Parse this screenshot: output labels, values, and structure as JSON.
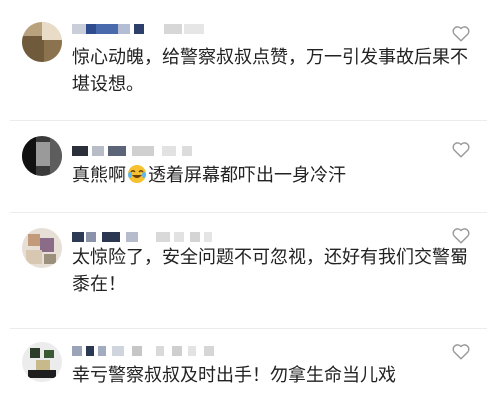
{
  "comments": [
    {
      "text": "惊心动魄，给警察叔叔点赞，万一引发事故后果不堪设想。",
      "username": "",
      "like_icon": "heart-outline-icon"
    },
    {
      "text_before_emoji": "真熊啊",
      "emoji": "laughing-crying-emoji",
      "text_after_emoji": "透着屏幕都吓出一身冷汗",
      "username": "",
      "like_icon": "heart-outline-icon"
    },
    {
      "text": "太惊险了，安全问题不可忽视，还好有我们交警蜀黍在！",
      "username": "",
      "like_icon": "heart-outline-icon"
    },
    {
      "text": "幸亏警察叔叔及时出手！勿拿生命当儿戏",
      "username": "",
      "like_icon": "heart-outline-icon"
    }
  ],
  "colors": {
    "text": "#222222",
    "divider": "#ececec",
    "icon": "#9a9a9a"
  }
}
